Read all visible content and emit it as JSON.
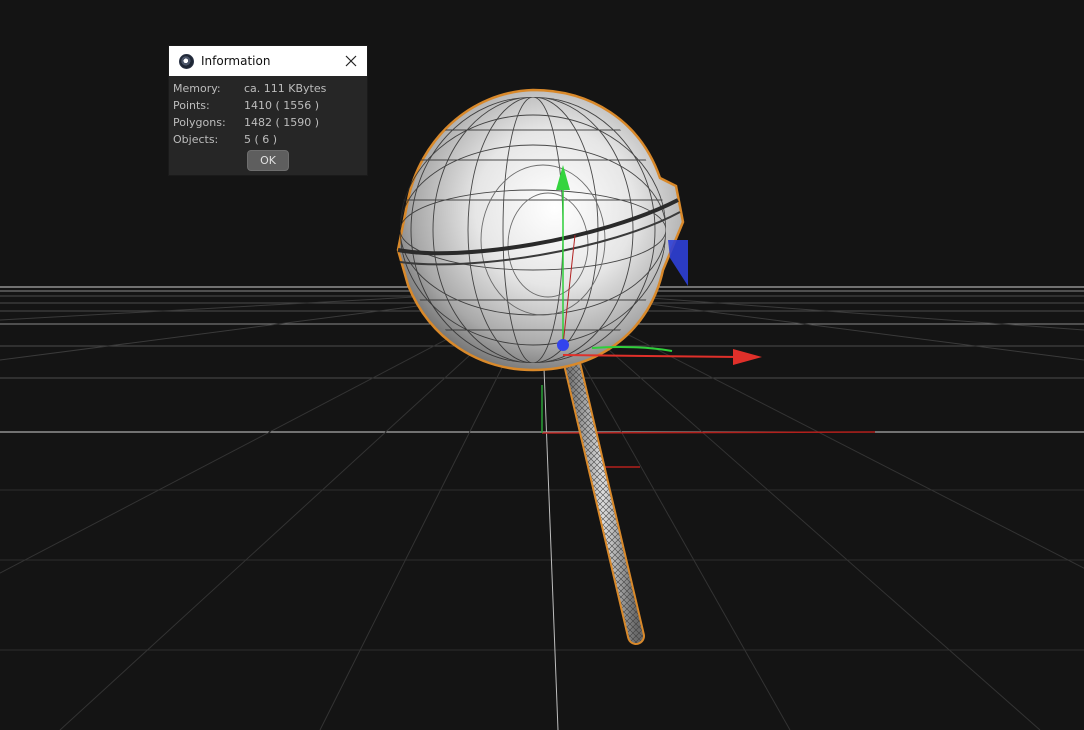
{
  "dialog": {
    "title": "Information",
    "rows": [
      {
        "label": "Memory:",
        "value": "ca. 111 KBytes"
      },
      {
        "label": "Points:",
        "value": "1410 ( 1556 )"
      },
      {
        "label": "Polygons:",
        "value": "1482 ( 1590 )"
      },
      {
        "label": "Objects:",
        "value": "5 ( 6 )"
      }
    ],
    "ok_label": "OK",
    "icons": {
      "app": "cinema4d-logo-icon",
      "close": "close-icon"
    }
  },
  "viewport": {
    "object": "lollipop",
    "colors": {
      "background": "#141414",
      "grid": "#5a5a5a",
      "selection_outline": "#d9892a",
      "axis_x": "#e0302a",
      "axis_y": "#2fcf3a",
      "axis_z": "#2d3fd6"
    }
  }
}
